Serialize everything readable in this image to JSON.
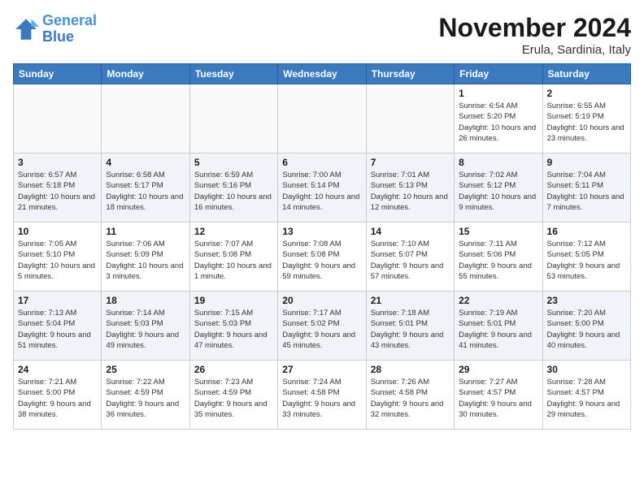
{
  "logo": {
    "line1": "General",
    "line2": "Blue"
  },
  "title": "November 2024",
  "subtitle": "Erula, Sardinia, Italy",
  "days_of_week": [
    "Sunday",
    "Monday",
    "Tuesday",
    "Wednesday",
    "Thursday",
    "Friday",
    "Saturday"
  ],
  "weeks": [
    [
      {
        "day": "",
        "info": ""
      },
      {
        "day": "",
        "info": ""
      },
      {
        "day": "",
        "info": ""
      },
      {
        "day": "",
        "info": ""
      },
      {
        "day": "",
        "info": ""
      },
      {
        "day": "1",
        "info": "Sunrise: 6:54 AM\nSunset: 5:20 PM\nDaylight: 10 hours and 26 minutes."
      },
      {
        "day": "2",
        "info": "Sunrise: 6:55 AM\nSunset: 5:19 PM\nDaylight: 10 hours and 23 minutes."
      }
    ],
    [
      {
        "day": "3",
        "info": "Sunrise: 6:57 AM\nSunset: 5:18 PM\nDaylight: 10 hours and 21 minutes."
      },
      {
        "day": "4",
        "info": "Sunrise: 6:58 AM\nSunset: 5:17 PM\nDaylight: 10 hours and 18 minutes."
      },
      {
        "day": "5",
        "info": "Sunrise: 6:59 AM\nSunset: 5:16 PM\nDaylight: 10 hours and 16 minutes."
      },
      {
        "day": "6",
        "info": "Sunrise: 7:00 AM\nSunset: 5:14 PM\nDaylight: 10 hours and 14 minutes."
      },
      {
        "day": "7",
        "info": "Sunrise: 7:01 AM\nSunset: 5:13 PM\nDaylight: 10 hours and 12 minutes."
      },
      {
        "day": "8",
        "info": "Sunrise: 7:02 AM\nSunset: 5:12 PM\nDaylight: 10 hours and 9 minutes."
      },
      {
        "day": "9",
        "info": "Sunrise: 7:04 AM\nSunset: 5:11 PM\nDaylight: 10 hours and 7 minutes."
      }
    ],
    [
      {
        "day": "10",
        "info": "Sunrise: 7:05 AM\nSunset: 5:10 PM\nDaylight: 10 hours and 5 minutes."
      },
      {
        "day": "11",
        "info": "Sunrise: 7:06 AM\nSunset: 5:09 PM\nDaylight: 10 hours and 3 minutes."
      },
      {
        "day": "12",
        "info": "Sunrise: 7:07 AM\nSunset: 5:08 PM\nDaylight: 10 hours and 1 minute."
      },
      {
        "day": "13",
        "info": "Sunrise: 7:08 AM\nSunset: 5:08 PM\nDaylight: 9 hours and 59 minutes."
      },
      {
        "day": "14",
        "info": "Sunrise: 7:10 AM\nSunset: 5:07 PM\nDaylight: 9 hours and 57 minutes."
      },
      {
        "day": "15",
        "info": "Sunrise: 7:11 AM\nSunset: 5:06 PM\nDaylight: 9 hours and 55 minutes."
      },
      {
        "day": "16",
        "info": "Sunrise: 7:12 AM\nSunset: 5:05 PM\nDaylight: 9 hours and 53 minutes."
      }
    ],
    [
      {
        "day": "17",
        "info": "Sunrise: 7:13 AM\nSunset: 5:04 PM\nDaylight: 9 hours and 51 minutes."
      },
      {
        "day": "18",
        "info": "Sunrise: 7:14 AM\nSunset: 5:03 PM\nDaylight: 9 hours and 49 minutes."
      },
      {
        "day": "19",
        "info": "Sunrise: 7:15 AM\nSunset: 5:03 PM\nDaylight: 9 hours and 47 minutes."
      },
      {
        "day": "20",
        "info": "Sunrise: 7:17 AM\nSunset: 5:02 PM\nDaylight: 9 hours and 45 minutes."
      },
      {
        "day": "21",
        "info": "Sunrise: 7:18 AM\nSunset: 5:01 PM\nDaylight: 9 hours and 43 minutes."
      },
      {
        "day": "22",
        "info": "Sunrise: 7:19 AM\nSunset: 5:01 PM\nDaylight: 9 hours and 41 minutes."
      },
      {
        "day": "23",
        "info": "Sunrise: 7:20 AM\nSunset: 5:00 PM\nDaylight: 9 hours and 40 minutes."
      }
    ],
    [
      {
        "day": "24",
        "info": "Sunrise: 7:21 AM\nSunset: 5:00 PM\nDaylight: 9 hours and 38 minutes."
      },
      {
        "day": "25",
        "info": "Sunrise: 7:22 AM\nSunset: 4:59 PM\nDaylight: 9 hours and 36 minutes."
      },
      {
        "day": "26",
        "info": "Sunrise: 7:23 AM\nSunset: 4:59 PM\nDaylight: 9 hours and 35 minutes."
      },
      {
        "day": "27",
        "info": "Sunrise: 7:24 AM\nSunset: 4:58 PM\nDaylight: 9 hours and 33 minutes."
      },
      {
        "day": "28",
        "info": "Sunrise: 7:26 AM\nSunset: 4:58 PM\nDaylight: 9 hours and 32 minutes."
      },
      {
        "day": "29",
        "info": "Sunrise: 7:27 AM\nSunset: 4:57 PM\nDaylight: 9 hours and 30 minutes."
      },
      {
        "day": "30",
        "info": "Sunrise: 7:28 AM\nSunset: 4:57 PM\nDaylight: 9 hours and 29 minutes."
      }
    ]
  ]
}
